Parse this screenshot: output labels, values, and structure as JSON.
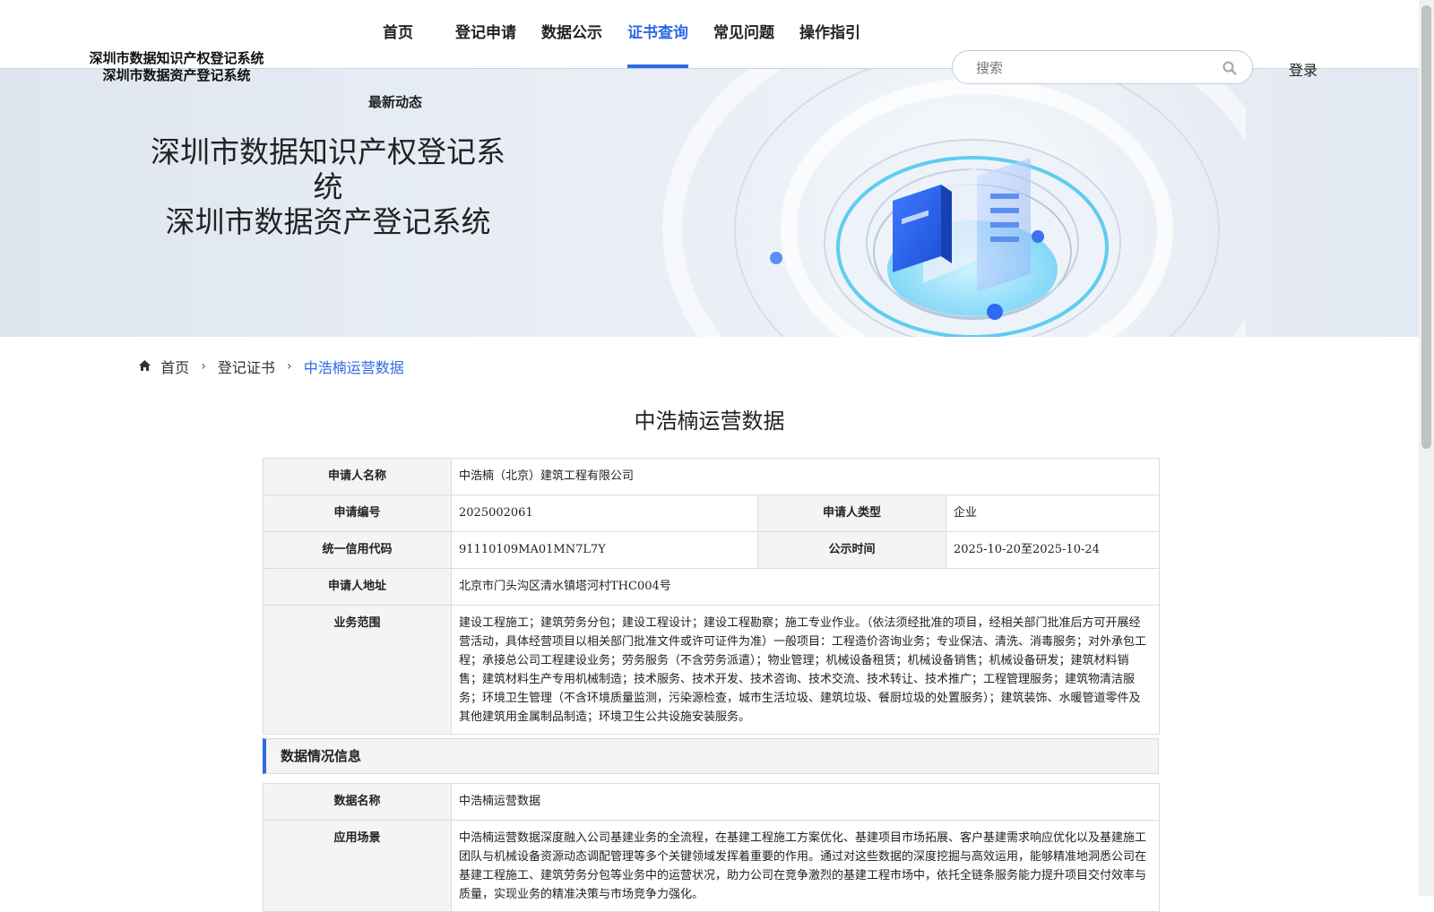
{
  "header": {
    "logo_line1": "深圳市数据知识产权登记系统",
    "logo_line2": "深圳市数据资产登记系统",
    "nav": [
      "首页",
      "登记申请",
      "数据公示",
      "证书查询",
      "常见问题",
      "操作指引"
    ],
    "active_nav": "证书查询",
    "nav_sub": "最新动态",
    "search_placeholder": "搜索",
    "login": "登录"
  },
  "banner": {
    "title_line1": "深圳市数据知识产权登记系统",
    "title_line2": "深圳市数据资产登记系统"
  },
  "breadcrumb": {
    "home": "首页",
    "level2": "登记证书",
    "current": "中浩楠运营数据"
  },
  "page_title": "中浩楠运营数据",
  "applicant": {
    "name_label": "申请人名称",
    "name": "中浩楠（北京）建筑工程有限公司",
    "app_no_label": "申请编号",
    "app_no": "2025002061",
    "type_label": "申请人类型",
    "type": "企业",
    "credit_label": "统一信用代码",
    "credit": "91110109MA01MN7L7Y",
    "publicity_label": "公示时间",
    "publicity": "2025-10-20至2025-10-24",
    "address_label": "申请人地址",
    "address": "北京市门头沟区清水镇塔河村THC004号",
    "scope_label": "业务范围",
    "scope": "建设工程施工；建筑劳务分包；建设工程设计；建设工程勘察；施工专业作业。（依法须经批准的项目，经相关部门批准后方可开展经营活动，具体经营项目以相关部门批准文件或许可证件为准）一般项目：工程造价咨询业务；专业保洁、清洗、消毒服务；对外承包工程；承接总公司工程建设业务；劳务服务（不含劳务派遣）；物业管理；机械设备租赁；机械设备销售；机械设备研发；建筑材料销售；建筑材料生产专用机械制造；技术服务、技术开发、技术咨询、技术交流、技术转让、技术推广；工程管理服务；建筑物清洁服务；环境卫生管理（不含环境质量监测，污染源检查，城市生活垃圾、建筑垃圾、餐厨垃圾的处置服务）；建筑装饰、水暖管道零件及其他建筑用金属制品制造；环境卫生公共设施安装服务。"
  },
  "data_section": {
    "title": "数据情况信息",
    "data_name_label": "数据名称",
    "data_name": "中浩楠运营数据",
    "scenario_label": "应用场景",
    "scenario": "中浩楠运营数据深度融入公司基建业务的全流程，在基建工程施工方案优化、基建项目市场拓展、客户基建需求响应优化以及基建施工团队与机械设备资源动态调配管理等多个关键领域发挥着重要的作用。通过对这些数据的深度挖掘与高效运用，能够精准地洞悉公司在基建工程施工、建筑劳务分包等业务中的运营状况，助力公司在竞争激烈的基建工程市场中，依托全链条服务能力提升项目交付效率与质量，实现业务的精准决策与市场竞争力强化。"
  },
  "colors": {
    "accent": "#2e6ae6",
    "label_bg": "#f4f4f4",
    "border": "#dcdcdc"
  }
}
